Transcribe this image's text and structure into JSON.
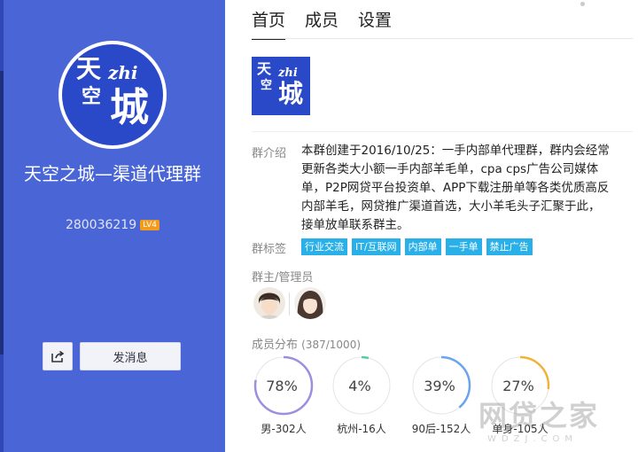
{
  "left_panel": {
    "logo_glyphs": [
      "天",
      "空",
      "zhi",
      "城"
    ],
    "group_name": "天空之城—渠道代理群",
    "group_id": "280036219",
    "level_badge": "LV4",
    "send_message_label": "发消息"
  },
  "tabs": [
    {
      "label": "首页",
      "active": true
    },
    {
      "label": "成员",
      "active": false
    },
    {
      "label": "设置",
      "active": false
    }
  ],
  "intro": {
    "label": "群介绍",
    "text": "本群创建于2016/10/25：一手内部单代理群，群内会经常更新各类大小额一手内部羊毛单，cpa cps广告公司媒体单，P2P网贷平台投资单、APP下载注册单等各类优质高反内部羊毛，网贷推广渠道首选，大小羊毛头子汇聚于此，接单放单联系群主。"
  },
  "tags": {
    "label": "群标签",
    "items": [
      "行业交流",
      "IT/互联网",
      "内部单",
      "一手单",
      "禁止广告"
    ]
  },
  "admins": {
    "label": "群主/管理员"
  },
  "distribution": {
    "label": "成员分布",
    "count": "(387/1000)",
    "stats": [
      {
        "percent": "78%",
        "value": 0.78,
        "caption": "男-302人",
        "color": "#9b8fe0"
      },
      {
        "percent": "4%",
        "value": 0.04,
        "caption": "杭州-16人",
        "color": "#5cc9a0"
      },
      {
        "percent": "39%",
        "value": 0.39,
        "caption": "90后-152人",
        "color": "#6aa3ee"
      },
      {
        "percent": "27%",
        "value": 0.27,
        "caption": "单身-105人",
        "color": "#f2b23a"
      }
    ]
  },
  "watermark": {
    "main": "网贷之家",
    "sub": "WDZJ.COM"
  },
  "colors": {
    "panel_blue": "#4a66d6",
    "tag_blue": "#2ab0e8",
    "badge_orange": "#f59b1b"
  }
}
